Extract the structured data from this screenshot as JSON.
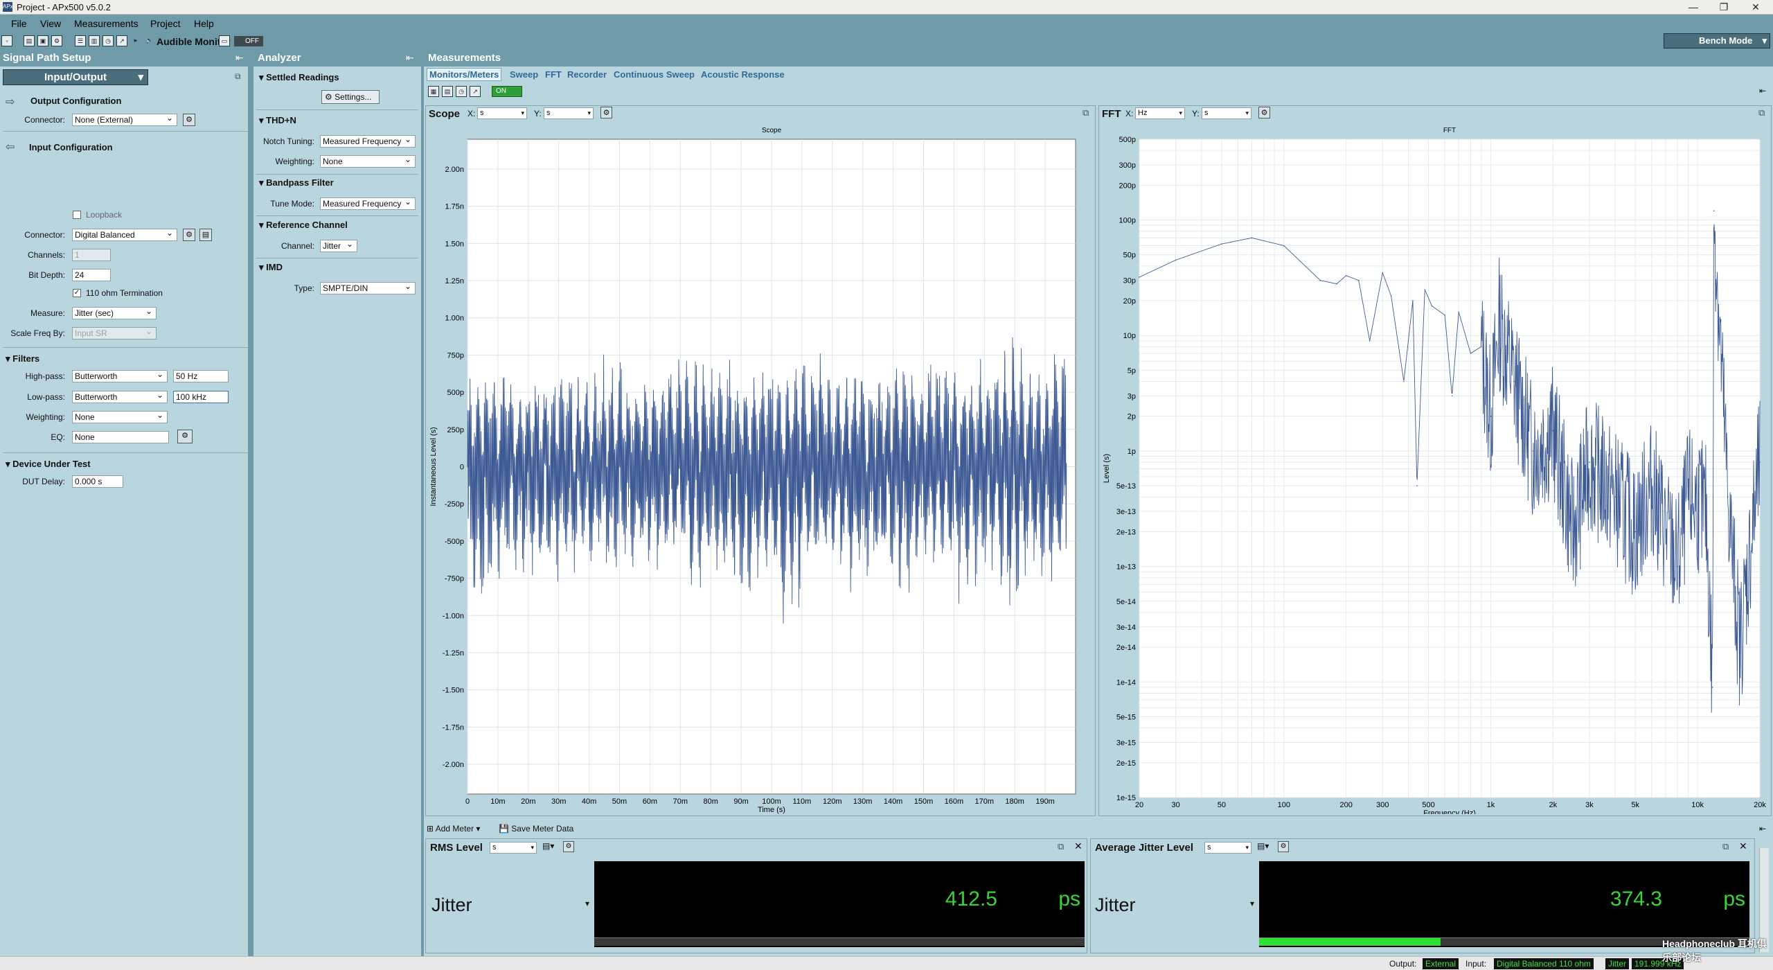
{
  "window": {
    "title": "Project - APx500 v5.0.2",
    "app_icon": "APx"
  },
  "menu": [
    "File",
    "View",
    "Measurements",
    "Project",
    "Help"
  ],
  "toolbar": {
    "audible_monitor_label": "Audible Monitor",
    "audible_state": "OFF",
    "bench_mode_label": "Bench Mode"
  },
  "signal_path": {
    "header": "Signal Path Setup",
    "io_selector": "Input/Output",
    "output_config_title": "Output Configuration",
    "output_connector_label": "Connector:",
    "output_connector_value": "None (External)",
    "input_config_title": "Input Configuration",
    "loopback_label": "Loopback",
    "input_connector_label": "Connector:",
    "input_connector_value": "Digital Balanced",
    "channels_label": "Channels:",
    "channels_value": "1",
    "bit_depth_label": "Bit Depth:",
    "bit_depth_value": "24",
    "termination_label": "110 ohm Termination",
    "measure_label": "Measure:",
    "measure_value": "Jitter (sec)",
    "scale_freq_label": "Scale Freq By:",
    "scale_freq_value": "Input SR",
    "filters_title": "Filters",
    "highpass_label": "High-pass:",
    "highpass_type": "Butterworth",
    "highpass_value": "50 Hz",
    "lowpass_label": "Low-pass:",
    "lowpass_type": "Butterworth",
    "lowpass_value": "100 kHz",
    "weighting_label": "Weighting:",
    "weighting_value": "None",
    "eq_label": "EQ:",
    "eq_value": "None",
    "dut_title": "Device Under Test",
    "dut_delay_label": "DUT Delay:",
    "dut_delay_value": "0.000 s"
  },
  "analyzer": {
    "header": "Analyzer",
    "settled_title": "Settled Readings",
    "settings_button": "Settings...",
    "thdn_title": "THD+N",
    "notch_label": "Notch Tuning:",
    "notch_value": "Measured Frequency",
    "weighting_label": "Weighting:",
    "weighting_value": "None",
    "bandpass_title": "Bandpass Filter",
    "tune_label": "Tune Mode:",
    "tune_value": "Measured Frequency",
    "refchan_title": "Reference Channel",
    "channel_label": "Channel:",
    "channel_value": "Jitter",
    "imd_title": "IMD",
    "type_label": "Type:",
    "type_value": "SMPTE/DIN"
  },
  "measurements": {
    "header": "Measurements",
    "tabs": [
      "Monitors/Meters",
      "Sweep",
      "FFT",
      "Recorder",
      "Continuous Sweep",
      "Acoustic Response"
    ],
    "on_label": "ON"
  },
  "scope": {
    "panel_title": "Scope",
    "x_label": "X:",
    "x_unit": "s",
    "y_label": "Y:",
    "y_unit": "s"
  },
  "fft": {
    "panel_title": "FFT",
    "x_label": "X:",
    "x_unit": "Hz",
    "y_label": "Y:",
    "y_unit": "s"
  },
  "chart_data": [
    {
      "type": "line",
      "title": "Scope",
      "xlabel": "Time (s)",
      "ylabel": "Instantaneous Level (s)",
      "xlim": [
        0,
        0.2
      ],
      "ylim": [
        -2.2e-09,
        2.2e-09
      ],
      "x_ticks": [
        "0",
        "10m",
        "20m",
        "30m",
        "40m",
        "50m",
        "60m",
        "70m",
        "80m",
        "90m",
        "100m",
        "110m",
        "120m",
        "130m",
        "140m",
        "150m",
        "160m",
        "170m",
        "180m",
        "190m"
      ],
      "y_ticks": [
        "2.00n",
        "1.75n",
        "1.50n",
        "1.25n",
        "1.00n",
        "750p",
        "500p",
        "250p",
        "0",
        "-250p",
        "-500p",
        "-750p",
        "-1.00n",
        "-1.25n",
        "-1.50n",
        "-1.75n",
        "-2.00n"
      ],
      "series": [
        {
          "envelope_max": [
            0.62,
            0.7,
            0.55,
            0.66,
            0.78,
            0.6,
            0.72,
            0.58,
            0.64,
            0.75,
            0.68,
            0.7,
            0.6,
            0.74,
            0.66,
            0.82,
            0.62,
            0.7,
            0.65,
            0.76,
            0.68,
            0.78,
            0.64,
            0.72,
            0.86,
            0.66,
            0.8
          ],
          "envelope_min": [
            -0.95,
            -0.7,
            -0.72,
            -0.68,
            -0.75,
            -0.62,
            -0.7,
            -0.66,
            -0.74,
            -0.64,
            -0.8,
            -0.7,
            -0.9,
            -0.76,
            -1.05,
            -0.72,
            -0.68,
            -0.8,
            -0.72,
            -0.88,
            -0.7,
            -0.66,
            -0.85,
            -0.72,
            -0.92,
            -0.74,
            -0.78
          ]
        }
      ]
    },
    {
      "type": "line",
      "title": "FFT",
      "xlabel": "Frequency (Hz)",
      "ylabel": "Level (s)",
      "x_scale": "log",
      "y_scale": "log",
      "xlim": [
        20,
        20000
      ],
      "ylim": [
        1e-15,
        5e-10
      ],
      "x_ticks": [
        "20",
        "30",
        "50",
        "100",
        "200",
        "300",
        "500",
        "1k",
        "2k",
        "3k",
        "5k",
        "10k",
        "20k"
      ],
      "y_ticks": [
        "500p",
        "300p",
        "200p",
        "100p",
        "50p",
        "30p",
        "20p",
        "10p",
        "5p",
        "3p",
        "2p",
        "1p",
        "5e-13",
        "3e-13",
        "2e-13",
        "1e-13",
        "5e-14",
        "3e-14",
        "2e-14",
        "1e-14",
        "5e-15",
        "3e-15",
        "2e-15",
        "1e-15"
      ],
      "series": [
        {
          "x": [
            20,
            30,
            50,
            70,
            100,
            150,
            180,
            200,
            230,
            260,
            300,
            330,
            380,
            420,
            440,
            480,
            520,
            600,
            650,
            700,
            800,
            900,
            1000,
            1100,
            1300,
            1600,
            2000,
            2500,
            3000,
            4000,
            5000,
            6000,
            8000,
            9000,
            11000,
            11800,
            12000,
            14000,
            16000,
            20000
          ],
          "y": [
            3.2e-11,
            4.5e-11,
            6.2e-11,
            7e-11,
            6e-11,
            3e-11,
            2.8e-11,
            3.3e-11,
            3e-11,
            9e-12,
            3.5e-11,
            2.2e-11,
            4e-12,
            2e-11,
            5e-13,
            2.5e-11,
            1.8e-11,
            1.5e-11,
            3e-12,
            1.6e-11,
            7e-12,
            8e-12,
            2e-12,
            1.3e-11,
            4e-12,
            1e-12,
            1.5e-12,
            2e-13,
            8e-13,
            4e-13,
            2e-13,
            5e-13,
            1e-13,
            4e-13,
            3e-13,
            9e-15,
            1.2e-10,
            4e-13,
            2e-14,
            8e-13
          ]
        }
      ]
    }
  ],
  "meters": {
    "add_meter_label": "Add Meter",
    "save_meter_label": "Save Meter Data",
    "rms": {
      "title": "RMS Level",
      "unit_select": "s",
      "channel": "Jitter",
      "value": "412.5",
      "unit": "ps",
      "bar_fraction": 0.0
    },
    "avg_jitter": {
      "title": "Average Jitter Level",
      "unit_select": "s",
      "channel": "Jitter",
      "value": "374.3",
      "unit": "ps",
      "bar_fraction": 0.37
    }
  },
  "status": {
    "output_label": "Output:",
    "output_value": "External",
    "input_label": "Input:",
    "input_value": "Digital Balanced 110 ohm",
    "input_mode": "Jitter",
    "sample_rate": "191.999 kHz"
  },
  "watermark": "Headphoneclub 耳机俱乐部论坛"
}
